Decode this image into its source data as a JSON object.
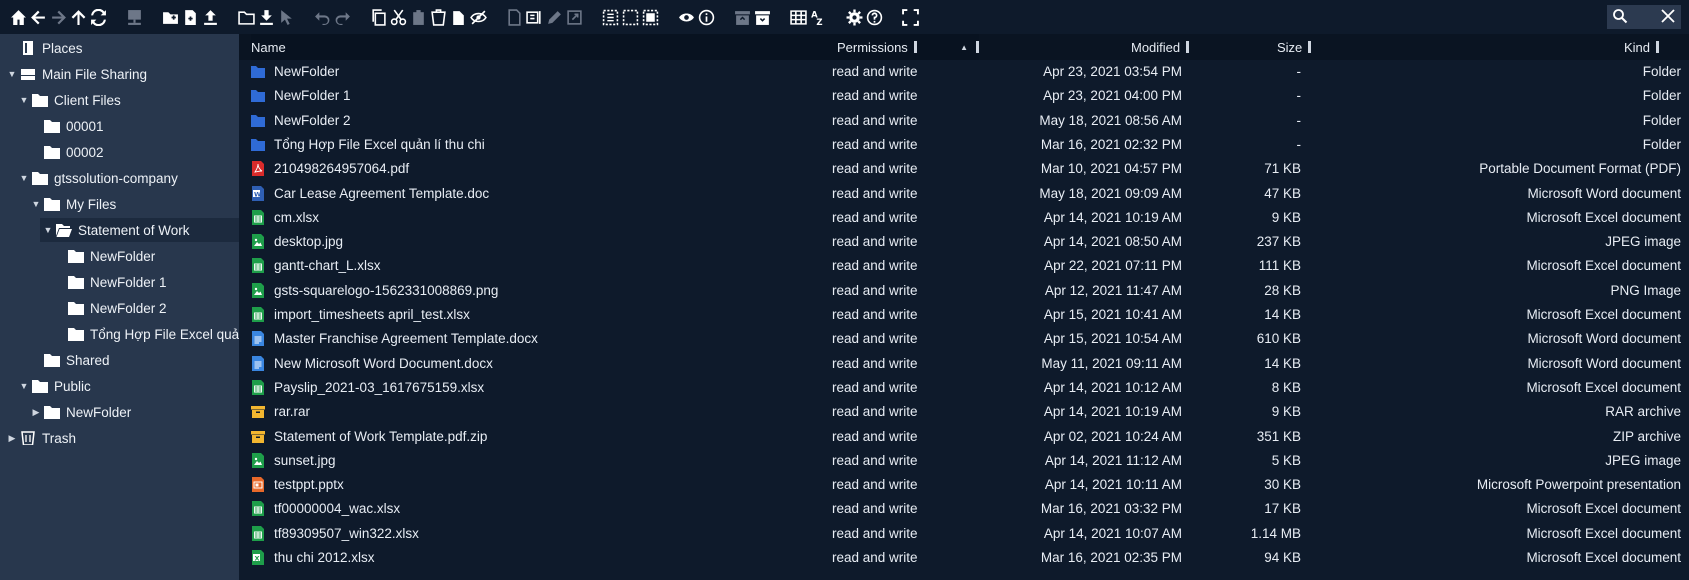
{
  "toolbar": {
    "buttons": [
      "home-icon",
      "back-icon",
      "forward-icon",
      "up-icon",
      "reload-icon",
      "network-drive-icon",
      "new-folder-icon",
      "new-file-icon",
      "upload-icon",
      "open-folder-icon",
      "download-icon",
      "select-pointer-icon",
      "undo-icon",
      "redo-icon",
      "copy-icon",
      "cut-icon",
      "paste-icon",
      "delete-icon",
      "duplicate-icon",
      "hide-icon",
      "rename-icon",
      "edit-text-icon",
      "edit-icon",
      "resize-icon",
      "select-all-icon",
      "select-none-icon",
      "invert-selection-icon",
      "preview-icon",
      "info-icon",
      "archive-icon",
      "extract-icon",
      "grid-view-icon",
      "sort-az-icon",
      "settings-icon",
      "help-icon",
      "fullscreen-icon"
    ]
  },
  "sidebar": {
    "items": [
      {
        "label": "Places"
      },
      {
        "label": "Main File Sharing"
      },
      {
        "label": "Client Files"
      },
      {
        "label": "00001"
      },
      {
        "label": "00002"
      },
      {
        "label": "gtssolution-company"
      },
      {
        "label": "My Files"
      },
      {
        "label": "Statement of Work"
      },
      {
        "label": "NewFolder"
      },
      {
        "label": "NewFolder 1"
      },
      {
        "label": "NewFolder 2"
      },
      {
        "label": "Tổng Hợp File Excel quản"
      },
      {
        "label": "Shared"
      },
      {
        "label": "Public"
      },
      {
        "label": "NewFolder"
      },
      {
        "label": "Trash"
      }
    ]
  },
  "columns": {
    "name": "Name",
    "permissions": "Permissions",
    "modified": "Modified",
    "size": "Size",
    "kind": "Kind"
  },
  "files": [
    {
      "name": "NewFolder",
      "perm": "read and write",
      "modified": "Apr 23, 2021 03:54 PM",
      "size": "-",
      "kind": "Folder",
      "icon": "folder",
      "color": "#2f6bd6"
    },
    {
      "name": "NewFolder 1",
      "perm": "read and write",
      "modified": "Apr 23, 2021 04:00 PM",
      "size": "-",
      "kind": "Folder",
      "icon": "folder",
      "color": "#2f6bd6"
    },
    {
      "name": "NewFolder 2",
      "perm": "read and write",
      "modified": "May 18, 2021 08:56 AM",
      "size": "-",
      "kind": "Folder",
      "icon": "folder",
      "color": "#2f6bd6"
    },
    {
      "name": "Tổng Hợp File Excel quản lí thu chi",
      "perm": "read and write",
      "modified": "Mar 16, 2021 02:32 PM",
      "size": "-",
      "kind": "Folder",
      "icon": "folder",
      "color": "#2f6bd6"
    },
    {
      "name": "210498264957064.pdf",
      "perm": "read and write",
      "modified": "Mar 10, 2021 04:57 PM",
      "size": "71 KB",
      "kind": "Portable Document Format (PDF)",
      "icon": "pdf",
      "color": "#d92b2b"
    },
    {
      "name": "Car Lease Agreement Template.doc",
      "perm": "read and write",
      "modified": "May 18, 2021 09:09 AM",
      "size": "47 KB",
      "kind": "Microsoft Word document",
      "icon": "word",
      "color": "#2f5fb3"
    },
    {
      "name": "cm.xlsx",
      "perm": "read and write",
      "modified": "Apr 14, 2021 10:19 AM",
      "size": "9 KB",
      "kind": "Microsoft Excel document",
      "icon": "sheet",
      "color": "#1e9e4a"
    },
    {
      "name": "desktop.jpg",
      "perm": "read and write",
      "modified": "Apr 14, 2021 08:50 AM",
      "size": "237 KB",
      "kind": "JPEG image",
      "icon": "image",
      "color": "#1e9e4a"
    },
    {
      "name": "gantt-chart_L.xlsx",
      "perm": "read and write",
      "modified": "Apr 22, 2021 07:11 PM",
      "size": "111 KB",
      "kind": "Microsoft Excel document",
      "icon": "sheet",
      "color": "#1e9e4a"
    },
    {
      "name": "gsts-squarelogo-1562331008869.png",
      "perm": "read and write",
      "modified": "Apr 12, 2021 11:47 AM",
      "size": "28 KB",
      "kind": "PNG Image",
      "icon": "image",
      "color": "#1e9e4a"
    },
    {
      "name": "import_timesheets april_test.xlsx",
      "perm": "read and write",
      "modified": "Apr 15, 2021 10:41 AM",
      "size": "14 KB",
      "kind": "Microsoft Excel document",
      "icon": "sheet",
      "color": "#1e9e4a"
    },
    {
      "name": "Master Franchise Agreement Template.docx",
      "perm": "read and write",
      "modified": "Apr 15, 2021 10:54 AM",
      "size": "610 KB",
      "kind": "Microsoft Word document",
      "icon": "doc",
      "color": "#3a86e0"
    },
    {
      "name": "New Microsoft Word Document.docx",
      "perm": "read and write",
      "modified": "May 11, 2021 09:11 AM",
      "size": "14 KB",
      "kind": "Microsoft Word document",
      "icon": "doc",
      "color": "#3a86e0"
    },
    {
      "name": "Payslip_2021-03_1617675159.xlsx",
      "perm": "read and write",
      "modified": "Apr 14, 2021 10:12 AM",
      "size": "8 KB",
      "kind": "Microsoft Excel document",
      "icon": "sheet",
      "color": "#1e9e4a"
    },
    {
      "name": "rar.rar",
      "perm": "read and write",
      "modified": "Apr 14, 2021 10:19 AM",
      "size": "9 KB",
      "kind": "RAR archive",
      "icon": "archive",
      "color": "#f2b630"
    },
    {
      "name": "Statement of Work Template.pdf.zip",
      "perm": "read and write",
      "modified": "Apr 02, 2021 10:24 AM",
      "size": "351 KB",
      "kind": "ZIP archive",
      "icon": "archive",
      "color": "#f2b630"
    },
    {
      "name": "sunset.jpg",
      "perm": "read and write",
      "modified": "Apr 14, 2021 11:12 AM",
      "size": "5 KB",
      "kind": "JPEG image",
      "icon": "image",
      "color": "#1e9e4a"
    },
    {
      "name": "testppt.pptx",
      "perm": "read and write",
      "modified": "Apr 14, 2021 10:11 AM",
      "size": "30 KB",
      "kind": "Microsoft Powerpoint presentation",
      "icon": "slides",
      "color": "#e8692a"
    },
    {
      "name": "tf00000004_wac.xlsx",
      "perm": "read and write",
      "modified": "Mar 16, 2021 03:32 PM",
      "size": "17 KB",
      "kind": "Microsoft Excel document",
      "icon": "sheet",
      "color": "#1e9e4a"
    },
    {
      "name": "tf89309507_win322.xlsx",
      "perm": "read and write",
      "modified": "Apr 14, 2021 10:07 AM",
      "size": "1.14 MB",
      "kind": "Microsoft Excel document",
      "icon": "sheet",
      "color": "#1e9e4a"
    },
    {
      "name": "thu chi 2012.xlsx",
      "perm": "read and write",
      "modified": "Mar 16, 2021 02:35 PM",
      "size": "94 KB",
      "kind": "Microsoft Excel document",
      "icon": "excel",
      "color": "#1e9e4a"
    }
  ]
}
